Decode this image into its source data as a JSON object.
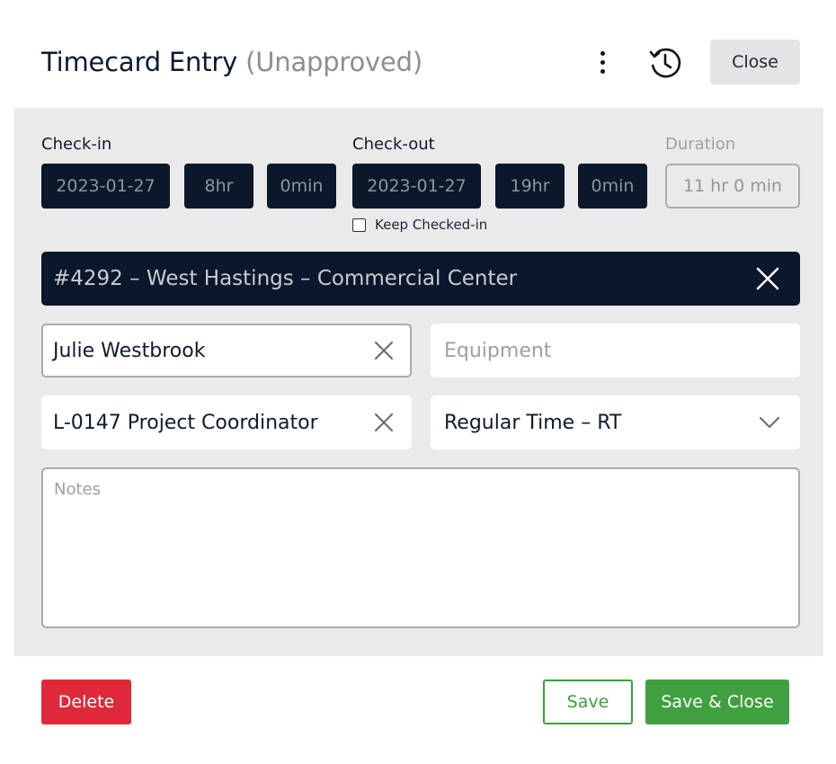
{
  "header": {
    "title": "Timecard Entry",
    "status": "(Unapproved)",
    "close_label": "Close"
  },
  "checkin": {
    "label": "Check-in",
    "date": "2023-01-27",
    "hour": "8hr",
    "minute": "0min"
  },
  "checkout": {
    "label": "Check-out",
    "date": "2023-01-27",
    "hour": "19hr",
    "minute": "0min"
  },
  "duration": {
    "label": "Duration",
    "value": "11 hr 0 min"
  },
  "keep_checked_in": {
    "label": "Keep Checked-in",
    "checked": false
  },
  "project": {
    "value": "#4292 – West Hastings – Commercial Center"
  },
  "employee": {
    "value": "Julie Westbrook"
  },
  "equipment": {
    "placeholder": "Equipment"
  },
  "labor_code": {
    "value": "L-0147 Project Coordinator"
  },
  "pay_type": {
    "value": "Regular Time – RT"
  },
  "notes": {
    "placeholder": "Notes"
  },
  "footer": {
    "delete_label": "Delete",
    "save_label": "Save",
    "save_close_label": "Save & Close"
  },
  "colors": {
    "dark_navy": "#0b172a",
    "panel_bg": "#ebeaeb",
    "delete_red": "#e0283b",
    "save_green": "#40a040"
  },
  "icons": [
    "more-vertical-icon",
    "history-icon",
    "close-x-icon",
    "chevron-down-icon"
  ]
}
